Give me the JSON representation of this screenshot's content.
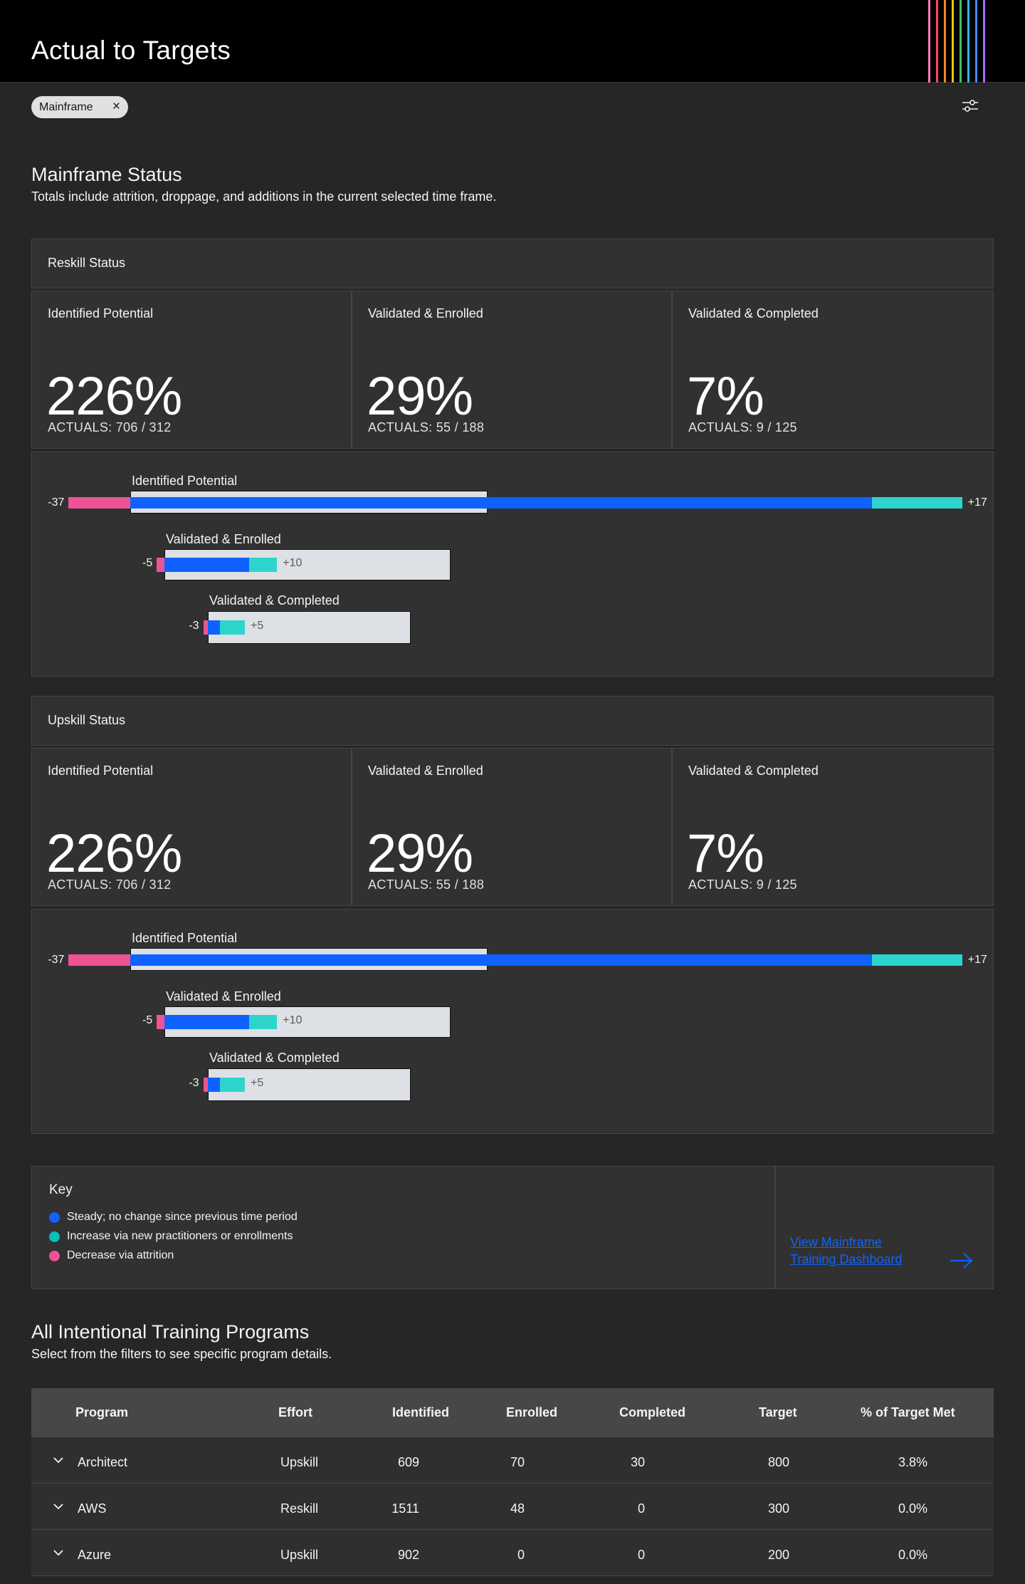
{
  "header": {
    "title": "Actual to Targets"
  },
  "brand_stripe_colors": [
    "#ff7eb6",
    "#fa4d56",
    "#ff832b",
    "#f1c21b",
    "#42be65",
    "#33b1ff",
    "#4589ff",
    "#a56eff"
  ],
  "filters": {
    "chip_label": "Mainframe",
    "remove_icon": "close-icon",
    "settings_icon": "settings-adjust-icon"
  },
  "status_section": {
    "title": "Mainframe Status",
    "subtitle": "Totals include attrition, droppage, and additions in the current selected time frame."
  },
  "panels": [
    {
      "title": "Reskill Status",
      "metrics": [
        {
          "label": "Identified Potential",
          "value": "226%",
          "actuals": "ACTUALS: 706 / 312"
        },
        {
          "label": "Validated & Enrolled",
          "value": "29%",
          "actuals": "ACTUALS: 55 / 188"
        },
        {
          "label": "Validated & Completed",
          "value": "7%",
          "actuals": "ACTUALS: 9 / 125"
        }
      ],
      "bars": [
        {
          "label": "Identified Potential",
          "target": 312,
          "steady": 726,
          "decrease": 37,
          "increase": 17,
          "decrease_label": "-37",
          "increase_label": "+17"
        },
        {
          "label": "Validated & Enrolled",
          "target": 188,
          "steady": 50,
          "decrease": 5,
          "increase": 10,
          "decrease_label": "-5",
          "increase_label": "+10"
        },
        {
          "label": "Validated & Completed",
          "target": 125,
          "steady": 7,
          "decrease": 3,
          "increase": 9,
          "decrease_label": "-3",
          "increase_label": "+5"
        }
      ]
    },
    {
      "title": "Upskill Status",
      "metrics": [
        {
          "label": "Identified Potential",
          "value": "226%",
          "actuals": "ACTUALS: 706 / 312"
        },
        {
          "label": "Validated & Enrolled",
          "value": "29%",
          "actuals": "ACTUALS: 55 / 188"
        },
        {
          "label": "Validated & Completed",
          "value": "7%",
          "actuals": "ACTUALS: 9 / 125"
        }
      ],
      "bars": [
        {
          "label": "Identified Potential",
          "target": 312,
          "steady": 726,
          "decrease": 37,
          "increase": 17,
          "decrease_label": "-37",
          "increase_label": "+17"
        },
        {
          "label": "Validated & Enrolled",
          "target": 188,
          "steady": 50,
          "decrease": 5,
          "increase": 10,
          "decrease_label": "-5",
          "increase_label": "+10"
        },
        {
          "label": "Validated & Completed",
          "target": 125,
          "steady": 7,
          "decrease": 3,
          "increase": 9,
          "decrease_label": "-3",
          "increase_label": "+5"
        }
      ]
    }
  ],
  "colors": {
    "steady": "#0f62fe",
    "increase": "#2dd4cc",
    "decrease": "#ee5396",
    "track": "#dde0e4",
    "link": "#0f62fe"
  },
  "key": {
    "title": "Key",
    "items": [
      {
        "label": "Steady; no change since previous time period",
        "color": "#0f62fe"
      },
      {
        "label": "Increase via new practitioners or enrollments",
        "color": "#08bdba"
      },
      {
        "label": "Decrease via attrition",
        "color": "#ee5396"
      }
    ],
    "link_label": "View Mainframe Training Dashboard",
    "link_icon": "arrow-right-icon"
  },
  "programs_section": {
    "title": "All Intentional Training Programs",
    "subtitle": "Select from the filters to see specific program details."
  },
  "table": {
    "headers": [
      "Program",
      "Effort",
      "Identified",
      "Enrolled",
      "Completed",
      "Target",
      "% of Target Met"
    ],
    "rows": [
      {
        "program": "Architect",
        "effort": "Upskill",
        "identified": "609",
        "enrolled": "70",
        "completed": "30",
        "target": "800",
        "pct": "3.8%"
      },
      {
        "program": "AWS",
        "effort": "Reskill",
        "identified": "1511",
        "enrolled": "48",
        "completed": "0",
        "target": "300",
        "pct": "0.0%"
      },
      {
        "program": "Azure",
        "effort": "Upskill",
        "identified": "902",
        "enrolled": "0",
        "completed": "0",
        "target": "200",
        "pct": "0.0%"
      }
    ]
  }
}
